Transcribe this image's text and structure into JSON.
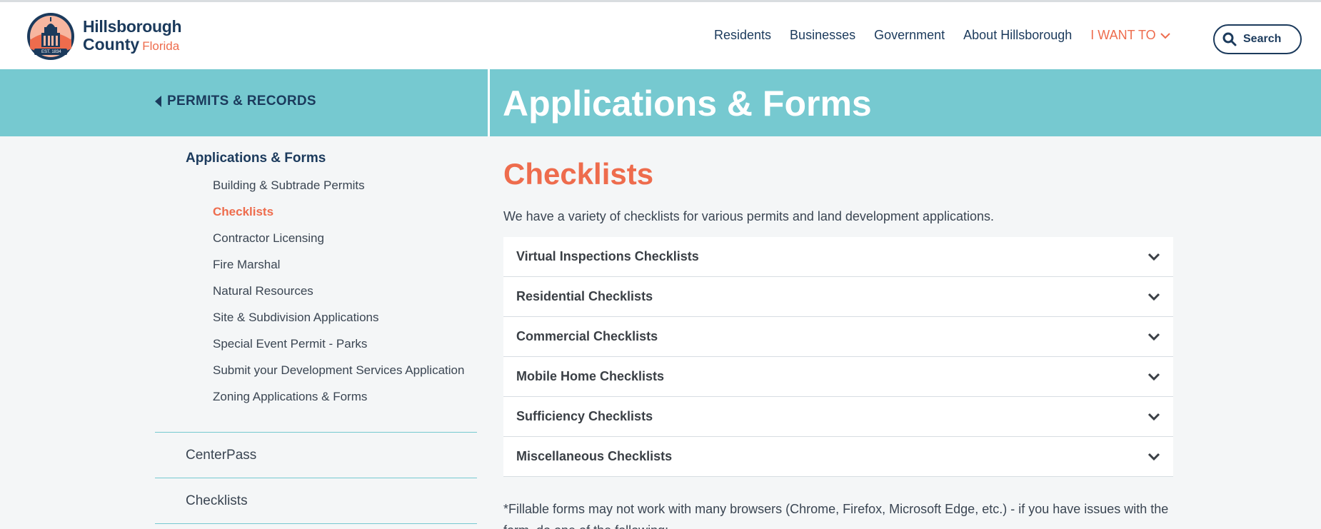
{
  "header": {
    "logo_line1": "Hillsborough",
    "logo_line2": "County",
    "logo_state": "Florida",
    "seal_text": "EST. 1834",
    "nav": [
      {
        "label": "Residents"
      },
      {
        "label": "Businesses"
      },
      {
        "label": "Government"
      },
      {
        "label": "About Hillsborough"
      }
    ],
    "want_label": "I WANT TO",
    "search_label": "Search"
  },
  "banner": {
    "back_label": "PERMITS & RECORDS",
    "title": "Applications & Forms"
  },
  "sidebar": {
    "heading": "Applications & Forms",
    "items": [
      {
        "label": "Building & Subtrade Permits"
      },
      {
        "label": "Checklists"
      },
      {
        "label": "Contractor Licensing"
      },
      {
        "label": "Fire Marshal"
      },
      {
        "label": "Natural Resources"
      },
      {
        "label": "Site & Subdivision Applications"
      },
      {
        "label": "Special Event Permit - Parks"
      },
      {
        "label": "Submit your Development Services Application"
      },
      {
        "label": "Zoning Applications & Forms"
      }
    ],
    "active_item": "Checklists",
    "links": [
      {
        "label": "CenterPass"
      },
      {
        "label": "Checklists"
      }
    ]
  },
  "main": {
    "title": "Checklists",
    "intro": "We have a variety of checklists for various permits and land development applications.",
    "accordion": [
      {
        "label": "Virtual Inspections Checklists"
      },
      {
        "label": "Residential Checklists"
      },
      {
        "label": "Commercial Checklists"
      },
      {
        "label": "Mobile Home Checklists"
      },
      {
        "label": "Sufficiency Checklists"
      },
      {
        "label": "Miscellaneous Checklists"
      }
    ],
    "footnote": "*Fillable forms may not work with many browsers (Chrome, Firefox, Microsoft Edge, etc.) - if you have issues with the form, do one of the following:"
  },
  "colors": {
    "navy": "#1b3a5c",
    "coral": "#ee6c4d",
    "teal": "#76c9d0",
    "background": "#f4f6f7"
  },
  "icons": {
    "back": "caret-left-icon",
    "search": "magnifier-icon",
    "want": "chevron-down-icon",
    "accordion": "chevron-down-icon"
  }
}
